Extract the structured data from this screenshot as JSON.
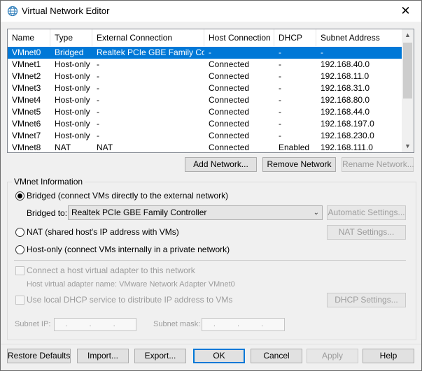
{
  "window": {
    "title": "Virtual Network Editor"
  },
  "table": {
    "headers": [
      "Name",
      "Type",
      "External Connection",
      "Host Connection",
      "DHCP",
      "Subnet Address"
    ],
    "rows": [
      [
        "VMnet0",
        "Bridged",
        "Realtek PCIe GBE Family Co...",
        "-",
        "-",
        "-"
      ],
      [
        "VMnet1",
        "Host-only",
        "-",
        "Connected",
        "-",
        "192.168.40.0"
      ],
      [
        "VMnet2",
        "Host-only",
        "-",
        "Connected",
        "-",
        "192.168.11.0"
      ],
      [
        "VMnet3",
        "Host-only",
        "-",
        "Connected",
        "-",
        "192.168.31.0"
      ],
      [
        "VMnet4",
        "Host-only",
        "-",
        "Connected",
        "-",
        "192.168.80.0"
      ],
      [
        "VMnet5",
        "Host-only",
        "-",
        "Connected",
        "-",
        "192.168.44.0"
      ],
      [
        "VMnet6",
        "Host-only",
        "-",
        "Connected",
        "-",
        "192.168.197.0"
      ],
      [
        "VMnet7",
        "Host-only",
        "-",
        "Connected",
        "-",
        "192.168.230.0"
      ],
      [
        "VMnet8",
        "NAT",
        "NAT",
        "Connected",
        "Enabled",
        "192.168.111.0"
      ]
    ],
    "selected_index": 0
  },
  "list_buttons": {
    "add_network": "Add Network...",
    "remove_network": "Remove Network",
    "rename_network": "Rename Network..."
  },
  "vmnet_info": {
    "group_label": "VMnet Information",
    "bridged_label": "Bridged (connect VMs directly to the external network)",
    "bridged_to_label": "Bridged to:",
    "bridged_to_value": "Realtek PCIe GBE Family Controller",
    "automatic_settings": "Automatic Settings...",
    "nat_label": "NAT (shared host's IP address with VMs)",
    "nat_settings": "NAT Settings...",
    "hostonly_label": "Host-only (connect VMs internally in a private network)",
    "connect_adapter_label": "Connect a host virtual adapter to this network",
    "adapter_name_label": "Host virtual adapter name: VMware Network Adapter VMnet0",
    "dhcp_label": "Use local DHCP service to distribute IP address to VMs",
    "dhcp_settings": "DHCP Settings...",
    "subnet_ip_label": "Subnet IP:",
    "subnet_mask_label": "Subnet mask:",
    "ip_placeholder": ". . .",
    "mask_placeholder": ". . ."
  },
  "footer": {
    "restore_defaults": "Restore Defaults",
    "import": "Import...",
    "export": "Export...",
    "ok": "OK",
    "cancel": "Cancel",
    "apply": "Apply",
    "help": "Help"
  },
  "colors": {
    "selection": "#0078d7",
    "window_bg": "#f0f0f0"
  },
  "icons": {
    "title": "globe-network-icon",
    "close": "close-icon"
  }
}
